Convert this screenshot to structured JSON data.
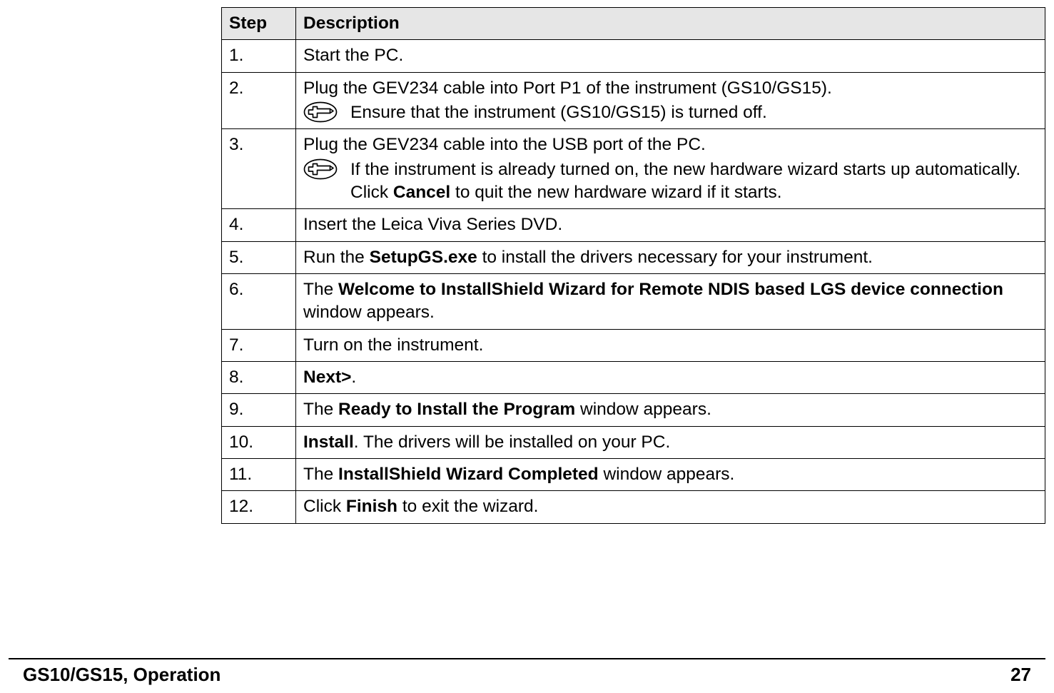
{
  "table": {
    "headers": {
      "step": "Step",
      "desc": "Description"
    },
    "rows": {
      "r1": {
        "num": "1.",
        "txt": "Start the PC."
      },
      "r2": {
        "num": "2.",
        "line1": "Plug the GEV234 cable into Port P1 of the instrument (GS10/GS15).",
        "note": "Ensure that the instrument (GS10/GS15) is turned off."
      },
      "r3": {
        "num": "3.",
        "line1": "Plug the GEV234 cable into the USB port of the PC.",
        "note_a": "If the instrument is already turned on, the new hardware wizard starts up automatically. Click ",
        "note_bold": "Cancel",
        "note_b": " to quit the new hardware wizard if it starts."
      },
      "r4": {
        "num": "4.",
        "txt": "Insert the Leica Viva Series DVD."
      },
      "r5": {
        "num": "5.",
        "a": "Run the ",
        "b": "SetupGS.exe",
        "c": " to install the drivers necessary for your instrument."
      },
      "r6": {
        "num": "6.",
        "a": "The ",
        "b": "Welcome to InstallShield Wizard for Remote NDIS based LGS device connection",
        "c": " window appears."
      },
      "r7": {
        "num": "7.",
        "txt": "Turn on the instrument."
      },
      "r8": {
        "num": "8.",
        "b": "Next>",
        "c": "."
      },
      "r9": {
        "num": "9.",
        "a": "The ",
        "b": "Ready to Install the Program",
        "c": " window appears."
      },
      "r10": {
        "num": "10.",
        "b": "Install",
        "c": ". The drivers will be installed on your PC."
      },
      "r11": {
        "num": "11.",
        "a": "The ",
        "b": "InstallShield Wizard Completed",
        "c": " window appears."
      },
      "r12": {
        "num": "12.",
        "a": "Click ",
        "b": "Finish",
        "c": " to exit the wizard."
      }
    }
  },
  "footer": {
    "left": "GS10/GS15, Operation",
    "right": "27"
  }
}
